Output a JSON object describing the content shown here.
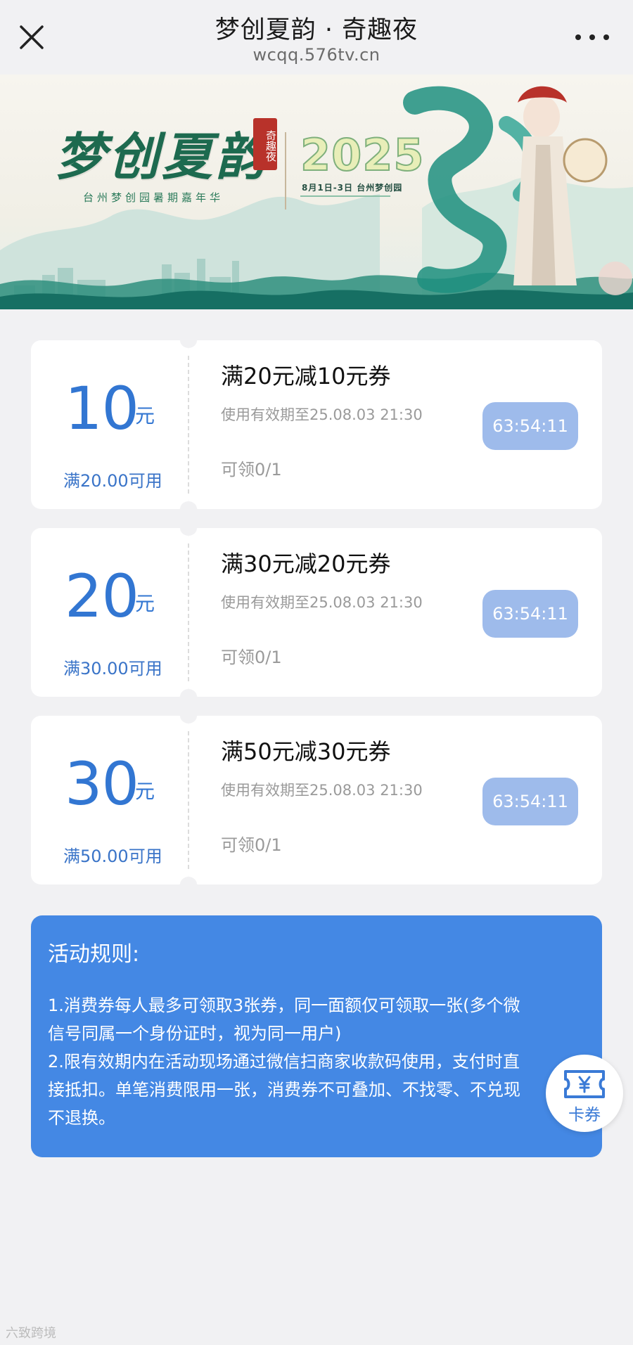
{
  "titlebar": {
    "title": "梦创夏韵 · 奇趣夜",
    "url": "wcqq.576tv.cn"
  },
  "banner": {
    "brand": "梦创夏韵",
    "seal": "奇趣夜",
    "subtitle": "台州梦创园暑期嘉年华",
    "year": "2025",
    "date_place": "8月1日-3日 台州梦创园"
  },
  "coupons": [
    {
      "amount": "10",
      "unit": "元",
      "condition": "满20.00可用",
      "title": "满20元减10元券",
      "validity": "使用有效期至25.08.03 21:30",
      "claimed": "可领0/1",
      "countdown": "63:54:11"
    },
    {
      "amount": "20",
      "unit": "元",
      "condition": "满30.00可用",
      "title": "满30元减20元券",
      "validity": "使用有效期至25.08.03 21:30",
      "claimed": "可领0/1",
      "countdown": "63:54:11"
    },
    {
      "amount": "30",
      "unit": "元",
      "condition": "满50.00可用",
      "title": "满50元减30元券",
      "validity": "使用有效期至25.08.03 21:30",
      "claimed": "可领0/1",
      "countdown": "63:54:11"
    }
  ],
  "rules": {
    "title": "活动规则:",
    "body": "1.消费券每人最多可领取3张券，同一面额仅可领取一张(多个微\n信号同属一个身份证时，视为同一用户)\n2.限有效期内在活动现场通过微信扫商家收款码使用，支付时直\n接抵扣。单笔消费限用一张，消费券不可叠加、不找零、不兑现\n不退换。"
  },
  "card_button": {
    "label": "卡券",
    "icon": "ticket-yen-icon"
  },
  "watermark": "六致跨境",
  "colors": {
    "accent": "#3276d2",
    "timer_bg": "#9ebbeb",
    "rules_bg": "#4488e4",
    "page_bg": "#f1f1f3"
  }
}
